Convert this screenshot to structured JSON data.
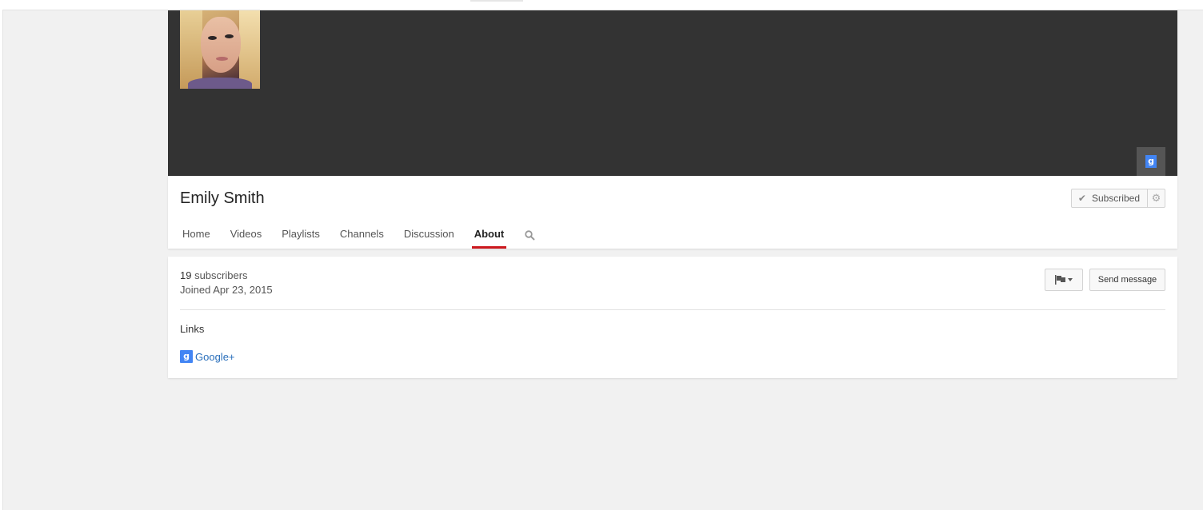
{
  "channel": {
    "name": "Emily Smith"
  },
  "subscribe": {
    "label": "Subscribed"
  },
  "tabs": [
    {
      "label": "Home"
    },
    {
      "label": "Videos"
    },
    {
      "label": "Playlists"
    },
    {
      "label": "Channels"
    },
    {
      "label": "Discussion"
    },
    {
      "label": "About"
    }
  ],
  "active_tab": "About",
  "about": {
    "subscriber_count": "19",
    "subscriber_suffix": " subscribers",
    "joined": "Joined Apr 23, 2015",
    "links_heading": "Links",
    "links": [
      {
        "label": "Google+",
        "icon": "google-plus-icon"
      }
    ],
    "send_message_label": "Send message"
  },
  "colors": {
    "banner": "#333333",
    "active_tab_underline": "#cc181e",
    "link": "#2a6fbb",
    "google_blue": "#4285f4",
    "page_background": "#f1f1f1"
  }
}
